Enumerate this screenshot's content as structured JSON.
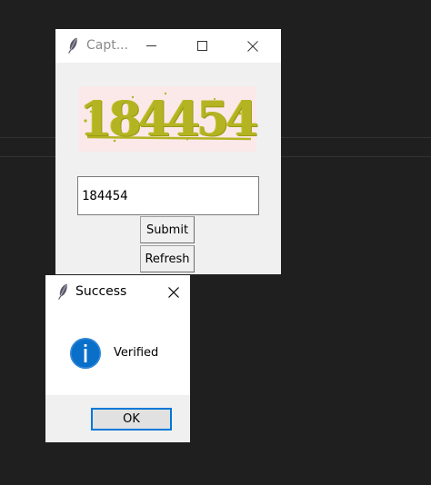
{
  "background": {
    "color": "#1f1f1f"
  },
  "captcha_window": {
    "title": "Capt...",
    "icon": "feather-icon",
    "controls": {
      "minimize": "minimize-icon",
      "maximize": "maximize-icon",
      "close": "close-icon"
    },
    "captcha_image": {
      "text": "184454",
      "text_color": "#b4b423",
      "background_color": "#fbe9ea"
    },
    "input": {
      "value": "184454"
    },
    "submit_label": "Submit",
    "refresh_label": "Refresh"
  },
  "success_dialog": {
    "title": "Success",
    "icon": "feather-icon",
    "close": "close-icon",
    "info_icon": "info-icon",
    "info_color": "#0a6fc9",
    "message": "Verified",
    "ok_label": "OK",
    "ok_border_color": "#0078d7"
  }
}
